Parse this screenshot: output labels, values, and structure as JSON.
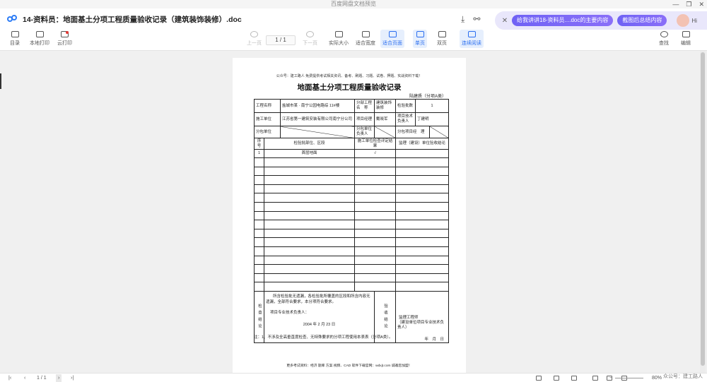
{
  "titlebar": {
    "text": "百度网盘文档预览",
    "min": "—",
    "restore": "❐",
    "close": "✕"
  },
  "header": {
    "doc_title": "14-资料员：地面基土分项工程质量验收记录（建筑装饰装修）.doc",
    "download_icon": "download-icon",
    "share_icon": "share-icon"
  },
  "ai": {
    "btn1": "给我讲讲18-资料员....doc的主要内容",
    "btn2": "截图后总结内容",
    "hi": "Hi"
  },
  "toolbar": {
    "toc": "目录",
    "local_print": "本地打印",
    "cloud_print": "云打印",
    "prev": "上一页",
    "page": "1 / 1",
    "next": "下一页",
    "actual": "实际大小",
    "fit_width": "适合宽度",
    "fit_page": "适合页面",
    "single": "单页",
    "double": "双页",
    "continuous": "连续阅读",
    "search": "查找",
    "edit": "编辑"
  },
  "document": {
    "note": "公众号：建工路人  免费提供考试相关资讯、备考、刷题、习题、试卷、押题、实战资料下载！",
    "title": "地面基土分项工程质量验收记录",
    "code": "陆建质（分项A类）",
    "r1": {
      "c1": "工程名称",
      "c2": "盐城市某 · 南宁公园电路综 11#楼",
      "c3": "分部工程名　称",
      "c4": "建筑装饰装修",
      "c5": "检验批数",
      "c6": "1"
    },
    "r2": {
      "c1": "施工单位",
      "c2": "江苏省第一建筑安装有限公司南宁分公司",
      "c3": "项目经理",
      "c4": "戴晓军",
      "c5": "项目技术负责人",
      "c6": "丁建明"
    },
    "r3": {
      "c1": "分包单位",
      "c3": "分包单位负责人",
      "c5": "分包项目经　理"
    },
    "h": {
      "c1": "序号",
      "c2": "检验批部位、区段",
      "c3": "施工单位检查评定结果",
      "c4": "监理（建设）单位验收结论"
    },
    "row1": {
      "no": "1",
      "part": "首层地面",
      "result": "√"
    },
    "footer_left": {
      "label": "检查结论",
      "text": "所含检验批无遗漏，各检验批所覆盖的区段和所含内容无遗漏，全部符合要求，本分项符合要求。",
      "sign": "项目专业技术负责人：",
      "date": "2004 年 2 月 23 日"
    },
    "footer_right": {
      "label": "验收结论",
      "sign1": "监理工程师",
      "sign2": "（建设单位项目专业技术负责人）",
      "date": "年　月　日"
    },
    "note_bottom": "注：1、不涉及全高垂直度检查、无特殊要求的分项工程使用本表表（分项A类）。",
    "foot": "更多考试资料：经济 题库 方案 视频、CAD 软件下载官网：wdxjt.com 诚邀您加盟！"
  },
  "bottombar": {
    "page": "1 / 1",
    "zoom": "80%"
  },
  "watermark": "众公号：建工路人"
}
